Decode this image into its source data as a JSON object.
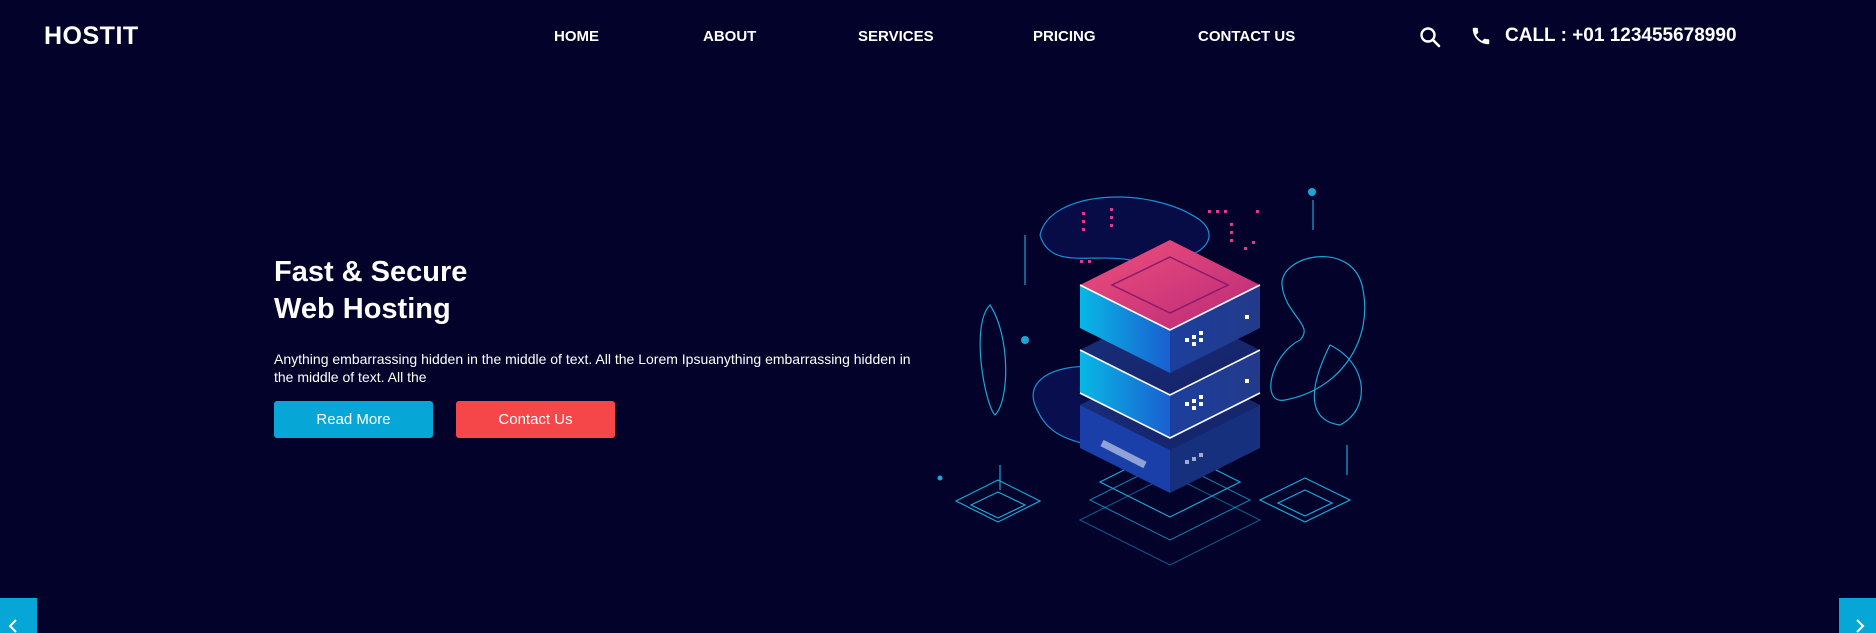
{
  "header": {
    "brand": "HOSTIT",
    "nav": [
      "HOME",
      "ABOUT",
      "SERVICES",
      "PRICING",
      "CONTACT US"
    ],
    "call": "CALL : +01 123455678990",
    "icons": [
      "search-icon",
      "phone-icon"
    ]
  },
  "hero": {
    "title_line1": "Fast & Secure",
    "title_line2": "Web Hosting",
    "text": "Anything embarrassing hidden in the middle of text. All the Lorem Ipsuanything embarrassing hidden in the middle of text. All the",
    "read_more": "Read More",
    "contact": "Contact Us"
  },
  "slider": {
    "prev_icon": "chevron-left-icon",
    "next_icon": "chevron-right-icon"
  },
  "colors": {
    "background": "#02022b",
    "accent_blue": "#06a7d6",
    "accent_red": "#f5474a",
    "text": "#ffffff"
  }
}
